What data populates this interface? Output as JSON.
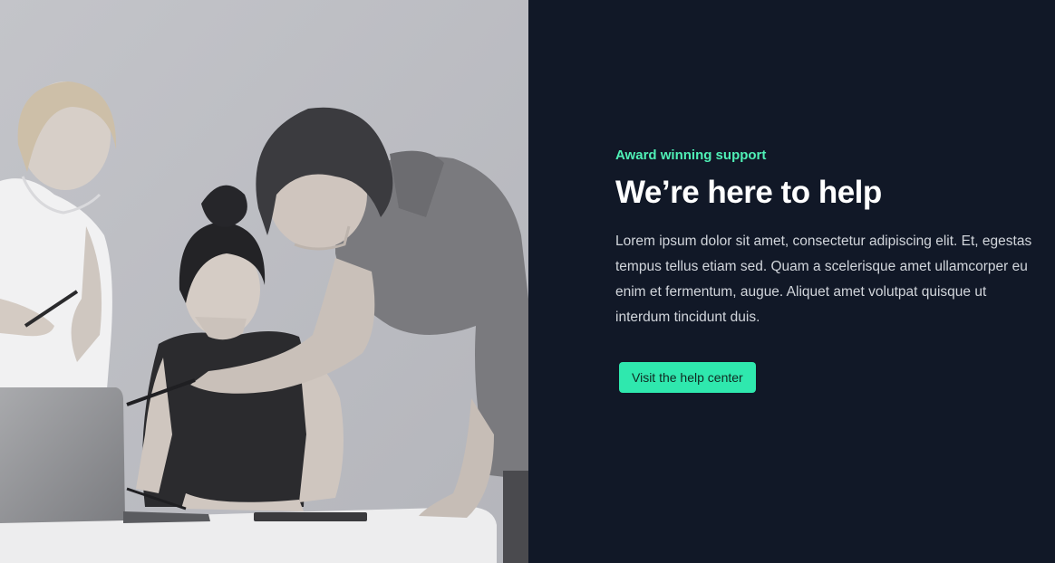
{
  "hero": {
    "eyebrow": "Award winning support",
    "title": "We’re here to help",
    "description": "Lorem ipsum dolor sit amet, consectetur adipiscing elit. Et, egestas tempus tellus etiam sed. Quam a scelerisque amet ullamcorper eu enim et fermentum, augue. Aliquet amet volutpat quisque ut interdum tincidunt duis.",
    "cta_label": "Visit the help center"
  },
  "colors": {
    "panel_background": "#111827",
    "accent": "#4ff0b6",
    "button": "#2fe8ae",
    "heading": "#ffffff",
    "body": "#d1d5db"
  },
  "image": {
    "subject": "team-working-at-laptop-photo",
    "treatment": "grayscale"
  }
}
